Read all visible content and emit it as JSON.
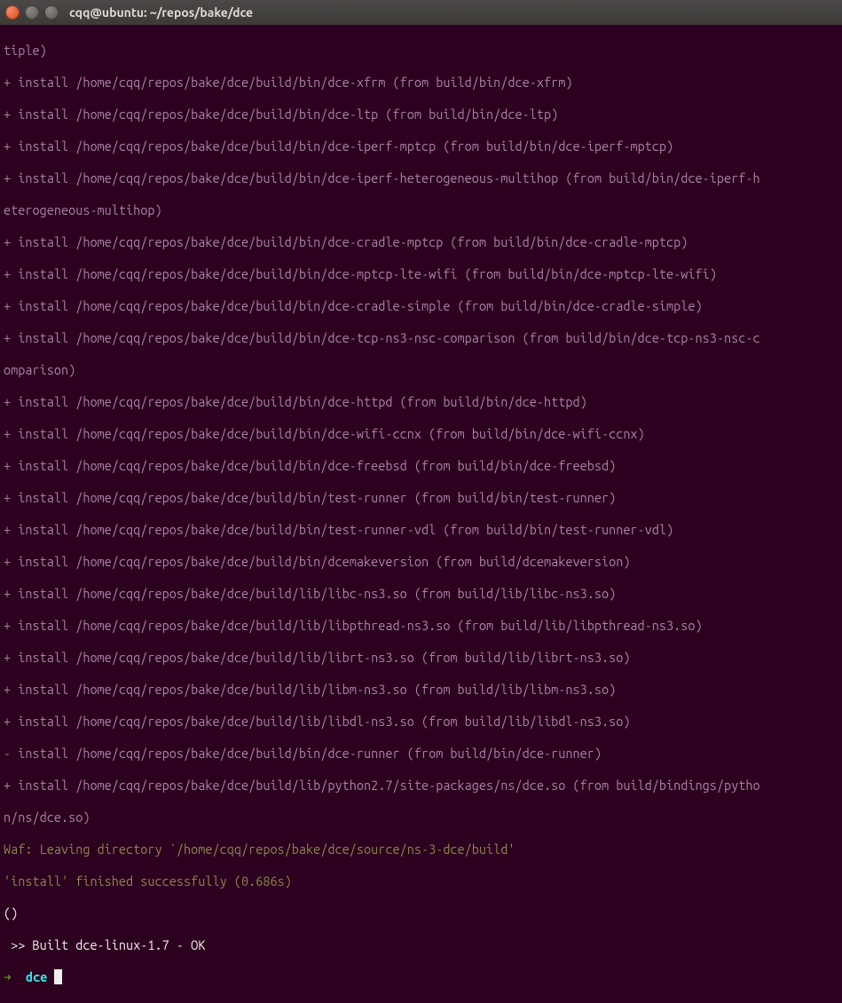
{
  "window": {
    "title": "cqq@ubuntu: ~/repos/bake/dce"
  },
  "lines": {
    "l00": "tiple)",
    "l01": "+ install /home/cqq/repos/bake/dce/build/bin/dce-xfrm (from build/bin/dce-xfrm)",
    "l02": "+ install /home/cqq/repos/bake/dce/build/bin/dce-ltp (from build/bin/dce-ltp)",
    "l03": "+ install /home/cqq/repos/bake/dce/build/bin/dce-iperf-mptcp (from build/bin/dce-iperf-mptcp)",
    "l04a": "+ install /home/cqq/repos/bake/dce/build/bin/dce-iperf-heterogeneous-multihop (from build/bin/dce-iperf-h",
    "l04b": "eterogeneous-multihop)",
    "l05": "+ install /home/cqq/repos/bake/dce/build/bin/dce-cradle-mptcp (from build/bin/dce-cradle-mptcp)",
    "l06": "+ install /home/cqq/repos/bake/dce/build/bin/dce-mptcp-lte-wifi (from build/bin/dce-mptcp-lte-wifi)",
    "l07": "+ install /home/cqq/repos/bake/dce/build/bin/dce-cradle-simple (from build/bin/dce-cradle-simple)",
    "l08a": "+ install /home/cqq/repos/bake/dce/build/bin/dce-tcp-ns3-nsc-comparison (from build/bin/dce-tcp-ns3-nsc-c",
    "l08b": "omparison)",
    "l09": "+ install /home/cqq/repos/bake/dce/build/bin/dce-httpd (from build/bin/dce-httpd)",
    "l10": "+ install /home/cqq/repos/bake/dce/build/bin/dce-wifi-ccnx (from build/bin/dce-wifi-ccnx)",
    "l11": "+ install /home/cqq/repos/bake/dce/build/bin/dce-freebsd (from build/bin/dce-freebsd)",
    "l12": "+ install /home/cqq/repos/bake/dce/build/bin/test-runner (from build/bin/test-runner)",
    "l13": "+ install /home/cqq/repos/bake/dce/build/bin/test-runner-vdl (from build/bin/test-runner-vdl)",
    "l14": "+ install /home/cqq/repos/bake/dce/build/bin/dcemakeversion (from build/dcemakeversion)",
    "l15": "+ install /home/cqq/repos/bake/dce/build/lib/libc-ns3.so (from build/lib/libc-ns3.so)",
    "l16": "+ install /home/cqq/repos/bake/dce/build/lib/libpthread-ns3.so (from build/lib/libpthread-ns3.so)",
    "l17": "+ install /home/cqq/repos/bake/dce/build/lib/librt-ns3.so (from build/lib/librt-ns3.so)",
    "l18": "+ install /home/cqq/repos/bake/dce/build/lib/libm-ns3.so (from build/lib/libm-ns3.so)",
    "l19": "+ install /home/cqq/repos/bake/dce/build/lib/libdl-ns3.so (from build/lib/libdl-ns3.so)",
    "l20": "- install /home/cqq/repos/bake/dce/build/bin/dce-runner (from build/bin/dce-runner)",
    "l21a": "+ install /home/cqq/repos/bake/dce/build/lib/python2.7/site-packages/ns/dce.so (from build/bindings/pytho",
    "l21b": "n/ns/dce.so)",
    "waf_leave": "Waf: Leaving directory `/home/cqq/repos/bake/dce/source/ns-3-dce/build'",
    "finish": "'install' finished successfully (0.686s)",
    "paren": "()",
    "built": " >> Built dce-linux-1.7 - OK",
    "prompt_arrow": "➜  ",
    "prompt_dir": "dce"
  }
}
